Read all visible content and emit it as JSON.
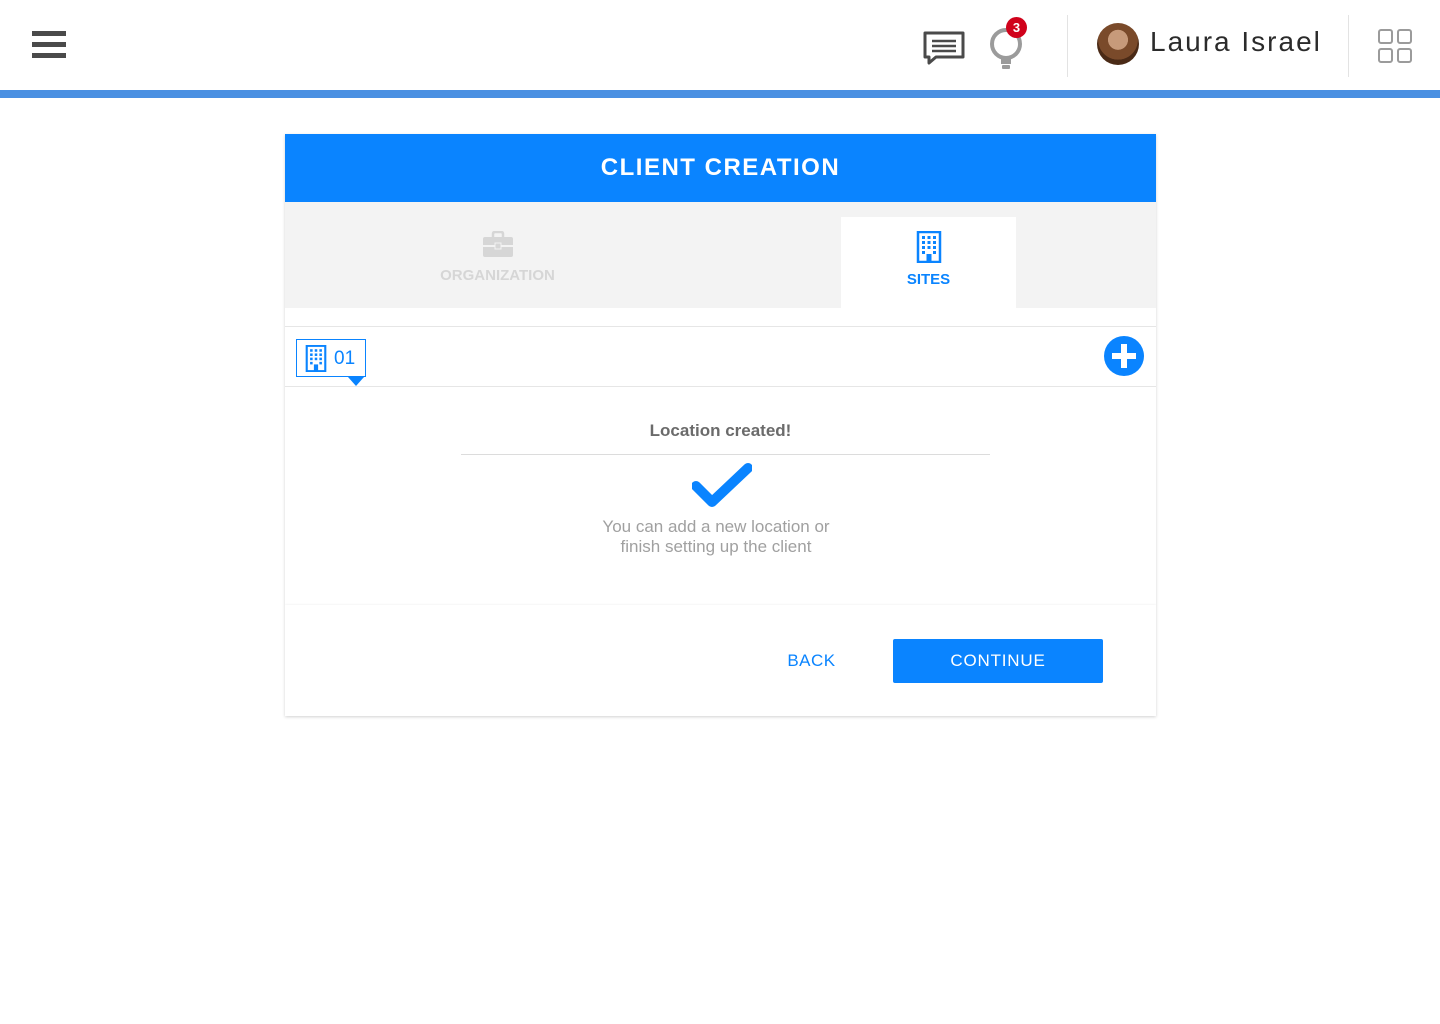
{
  "header": {
    "notifications_count": "3",
    "user_name": "Laura Israel"
  },
  "card": {
    "title": "CLIENT CREATION",
    "tabs": [
      {
        "label": "ORGANIZATION",
        "active": false
      },
      {
        "label": "SITES",
        "active": true
      }
    ],
    "sites": [
      {
        "number": "01",
        "selected": true
      }
    ],
    "success": {
      "title": "Location created!",
      "message_line1": "You can add a new location or",
      "message_line2": "finish setting up the client"
    }
  },
  "footer": {
    "back_label": "BACK",
    "continue_label": "CONTINUE"
  },
  "colors": {
    "accent": "#0a84ff",
    "topbar_line": "#4a90e2",
    "badge": "#d0021b"
  },
  "icons": {
    "menu": "hamburger-icon",
    "chat": "chat-icon",
    "notifications": "lightbulb-icon",
    "apps": "apps-grid-icon",
    "organization_tab": "briefcase-icon",
    "sites_tab": "building-icon",
    "add_site": "plus-circle-icon",
    "success": "checkmark-icon"
  }
}
